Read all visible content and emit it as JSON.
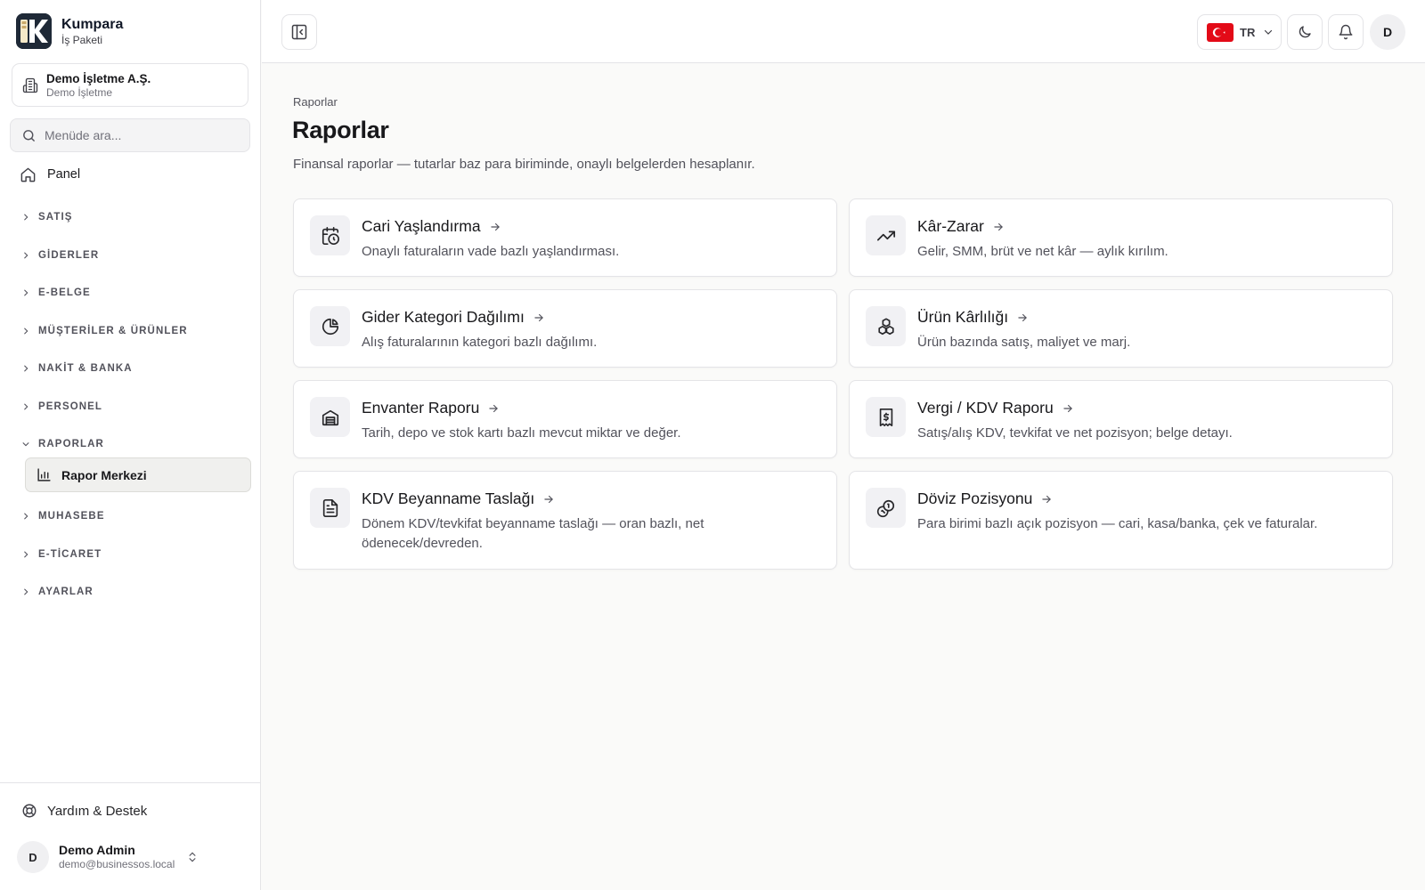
{
  "brand": {
    "name": "Kumpara",
    "subtitle": "İş Paketi"
  },
  "company": {
    "name": "Demo İşletme A.Ş.",
    "subtitle": "Demo İşletme"
  },
  "search": {
    "placeholder": "Menüde ara..."
  },
  "nav": {
    "panel": "Panel",
    "groups": [
      "SATIŞ",
      "GİDERLER",
      "E-BELGE",
      "MÜŞTERİLER & ÜRÜNLER",
      "NAKİT & BANKA",
      "PERSONEL",
      "RAPORLAR",
      "MUHASEBE",
      "E-TİCARET",
      "AYARLAR"
    ],
    "active_item": "Rapor Merkezi"
  },
  "footer": {
    "help": "Yardım & Destek",
    "user_initial": "D",
    "user_name": "Demo Admin",
    "user_email": "demo@businessos.local"
  },
  "topbar": {
    "lang_code": "TR",
    "avatar_initial": "D",
    "flag_color": "#e30a17"
  },
  "page": {
    "breadcrumb": "Raporlar",
    "title": "Raporlar",
    "description": "Finansal raporlar — tutarlar baz para biriminde, onaylı belgelerden hesaplanır."
  },
  "cards": [
    {
      "title": "Cari Yaşlandırma",
      "desc": "Onaylı faturaların vade bazlı yaşlandırması.",
      "icon": "calendar-clock-icon"
    },
    {
      "title": "Kâr-Zarar",
      "desc": "Gelir, SMM, brüt ve net kâr — aylık kırılım.",
      "icon": "trending-up-icon"
    },
    {
      "title": "Gider Kategori Dağılımı",
      "desc": "Alış faturalarının kategori bazlı dağılımı.",
      "icon": "pie-chart-icon"
    },
    {
      "title": "Ürün Kârlılığı",
      "desc": "Ürün bazında satış, maliyet ve marj.",
      "icon": "boxes-icon"
    },
    {
      "title": "Envanter Raporu",
      "desc": "Tarih, depo ve stok kartı bazlı mevcut miktar ve değer.",
      "icon": "warehouse-icon"
    },
    {
      "title": "Vergi / KDV Raporu",
      "desc": "Satış/alış KDV, tevkifat ve net pozisyon; belge detayı.",
      "icon": "receipt-icon"
    },
    {
      "title": "KDV Beyanname Taslağı",
      "desc": "Dönem KDV/tevkifat beyanname taslağı — oran bazlı, net ödenecek/devreden.",
      "icon": "file-text-icon"
    },
    {
      "title": "Döviz Pozisyonu",
      "desc": "Para birimi bazlı açık pozisyon — cari, kasa/banka, çek ve faturalar.",
      "icon": "coins-icon"
    }
  ]
}
